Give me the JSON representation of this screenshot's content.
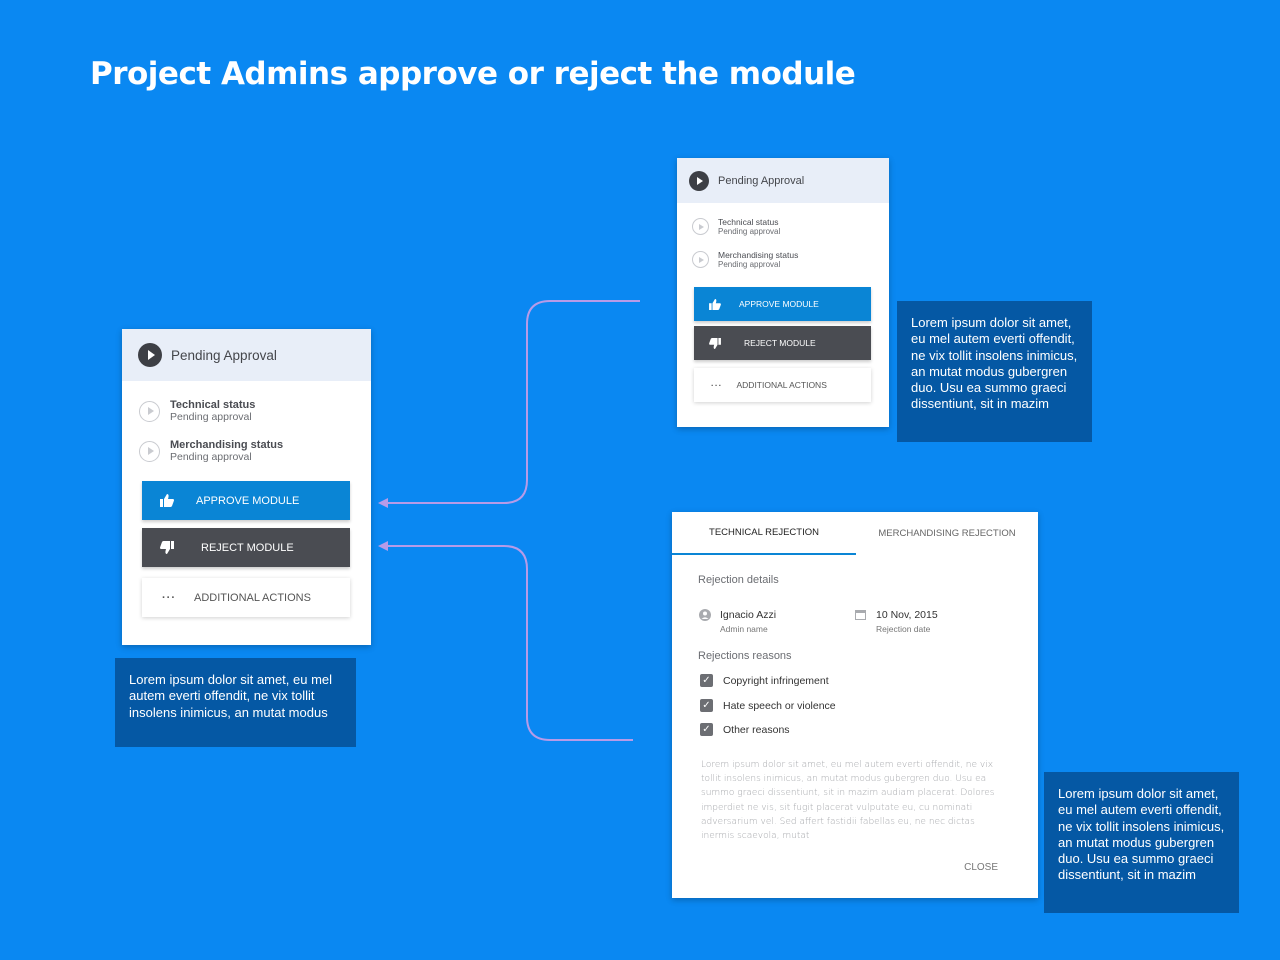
{
  "page_title": "Project Admins approve or reject the module",
  "card_large": {
    "header": "Pending Approval",
    "statuses": [
      {
        "title": "Technical status",
        "sub": "Pending approval"
      },
      {
        "title": "Merchandising status",
        "sub": "Pending approval"
      }
    ],
    "approve": "APPROVE MODULE",
    "reject": "REJECT MODULE",
    "more": "ADDITIONAL ACTIONS"
  },
  "card_small": {
    "header": "Pending Approval",
    "statuses": [
      {
        "title": "Technical status",
        "sub": "Pending approval"
      },
      {
        "title": "Merchandising status",
        "sub": "Pending approval"
      }
    ],
    "approve": "APPROVE MODULE",
    "reject": "REJECT MODULE",
    "more": "ADDITIONAL ACTIONS"
  },
  "notes": {
    "left": "Lorem ipsum dolor sit amet, eu mel autem everti offendit, ne vix tollit insolens inimicus, an mutat modus",
    "top_right": "Lorem ipsum dolor sit amet, eu mel autem everti offendit, ne vix tollit insolens inimicus, an mutat modus gubergren duo. Usu ea summo graeci dissentiunt, sit in mazim",
    "bottom_right": "Lorem ipsum dolor sit amet, eu mel autem everti offendit, ne vix tollit insolens inimicus, an mutat modus gubergren duo. Usu ea summo graeci dissentiunt, sit in mazim"
  },
  "dialog": {
    "tabs": [
      "TECHNICAL REJECTION",
      "MERCHANDISING REJECTION"
    ],
    "details_label": "Rejection details",
    "admin_name": "Ignacio Azzi",
    "admin_label": "Admin name",
    "date": "10 Nov, 2015",
    "date_label": "Rejection date",
    "reasons_label": "Rejections reasons",
    "reasons": [
      "Copyright infringement",
      "Hate speech or violence",
      "Other reasons"
    ],
    "body": "Lorem ipsum dolor sit amet, eu mel autem everti offendit, ne vix tollit insolens inimicus, an mutat modus gubergren duo. Usu ea summo graeci dissentiunt, sit in mazim audiam placerat. Dolores imperdiet ne vis, sit fugit placerat vulputate eu, cu nominati adversarium vel. Sed affert fastidii fabellas eu, ne nec dictas inermis scaevola, mutat",
    "close": "CLOSE"
  },
  "colors": {
    "background": "#0a88f2",
    "approve": "#0a85d5",
    "reject": "#4a4c52",
    "note": "#0558a4",
    "connector": "#b79be8"
  }
}
